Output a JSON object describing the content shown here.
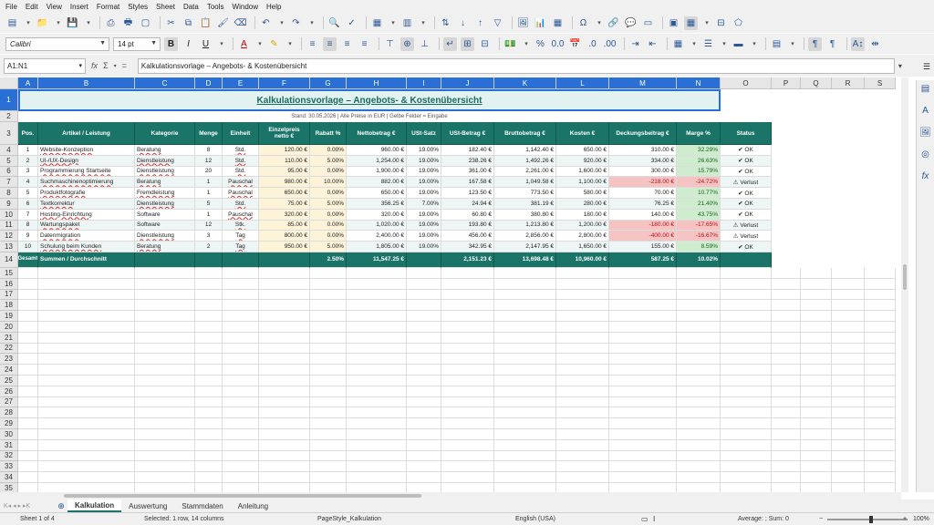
{
  "menu": [
    "File",
    "Edit",
    "View",
    "Insert",
    "Format",
    "Styles",
    "Sheet",
    "Data",
    "Tools",
    "Window",
    "Help"
  ],
  "toolbar": {
    "font_name": "Calibri",
    "font_size": "14 pt"
  },
  "formula_bar": {
    "name_box": "A1:N1",
    "sigma": "Σ",
    "equals": "=",
    "fx": "fx",
    "content": "Kalkulationsvorlage – Angebots- & Kostenübersicht"
  },
  "columns": [
    "A",
    "B",
    "C",
    "D",
    "E",
    "F",
    "G",
    "H",
    "I",
    "J",
    "K",
    "L",
    "M",
    "N",
    "O",
    "P",
    "Q",
    "R",
    "S"
  ],
  "rows": [
    "1",
    "2",
    "3",
    "4",
    "5",
    "6",
    "7",
    "8",
    "9",
    "10",
    "11",
    "12",
    "13",
    "14",
    "15",
    "16",
    "17",
    "18",
    "19",
    "20",
    "21",
    "22",
    "23",
    "24",
    "25",
    "26",
    "27",
    "28",
    "29",
    "30",
    "31",
    "32",
    "33",
    "34",
    "35",
    "36",
    "37"
  ],
  "sheet": {
    "title": "Kalkulationsvorlage – Angebots- & Kostenübersicht",
    "subtitle": "Stand: 30.05.2026  |  Alle Preise in EUR  |  Gelbe Felder = Eingabe",
    "headers": [
      "Pos.",
      "Artikel / Leistung",
      "Kategorie",
      "Menge",
      "Einheit",
      "Einzelpreis netto €",
      "Rabatt %",
      "Nettobetrag €",
      "USt-Satz",
      "USt-Betrag €",
      "Bruttobetrag €",
      "Kosten €",
      "Deckungsbeitrag €",
      "Marge %",
      "Status"
    ],
    "data": [
      [
        "1",
        "Website-Konzeption",
        "Beratung",
        "8",
        "Std.",
        "120.00 €",
        "0.00%",
        "960.00 €",
        "19.00%",
        "182.40 €",
        "1,142.40 €",
        "650.00 €",
        "310.00 €",
        "32.29%",
        "✔ OK"
      ],
      [
        "2",
        "UI-/UX-Design",
        "Dienstleistung",
        "12",
        "Std.",
        "110.00 €",
        "5.00%",
        "1,254.00 €",
        "19.00%",
        "238.26 €",
        "1,492.26 €",
        "920.00 €",
        "334.00 €",
        "26.63%",
        "✔ OK"
      ],
      [
        "3",
        "Programmierung Startseite",
        "Dienstleistung",
        "20",
        "Std.",
        "95.00 €",
        "0.00%",
        "1,900.00 €",
        "19.00%",
        "361.00 €",
        "2,261.00 €",
        "1,600.00 €",
        "300.00 €",
        "15.79%",
        "✔ OK"
      ],
      [
        "4",
        "Suchmaschinenoptimierung",
        "Beratung",
        "1",
        "Pauschal",
        "980.00 €",
        "10.00%",
        "882.00 €",
        "19.00%",
        "167.58 €",
        "1,049.58 €",
        "1,100.00 €",
        "-218.00 €",
        "-24.72%",
        "⚠ Verlust"
      ],
      [
        "5",
        "Produktfotografie",
        "Fremdleistung",
        "1",
        "Pauschal",
        "650.00 €",
        "0.00%",
        "650.00 €",
        "19.00%",
        "123.50 €",
        "773.50 €",
        "580.00 €",
        "70.00 €",
        "10.77%",
        "✔ OK"
      ],
      [
        "6",
        "Textkorrektur",
        "Dienstleistung",
        "5",
        "Std.",
        "75.00 €",
        "5.00%",
        "356.25 €",
        "7.00%",
        "24.94 €",
        "381.19 €",
        "280.00 €",
        "76.25 €",
        "21.40%",
        "✔ OK"
      ],
      [
        "7",
        "Hosting-Einrichtung",
        "Software",
        "1",
        "Pauschal",
        "320.00 €",
        "0.00%",
        "320.00 €",
        "19.00%",
        "60.80 €",
        "380.80 €",
        "180.00 €",
        "140.00 €",
        "43.75%",
        "✔ OK"
      ],
      [
        "8",
        "Wartungspaket",
        "Software",
        "12",
        "Stk.",
        "85.00 €",
        "0.00%",
        "1,020.00 €",
        "19.00%",
        "193.80 €",
        "1,213.80 €",
        "1,200.00 €",
        "-180.00 €",
        "-17.65%",
        "⚠ Verlust"
      ],
      [
        "9",
        "Datenmigration",
        "Dienstleistung",
        "3",
        "Tag",
        "800.00 €",
        "0.00%",
        "2,400.00 €",
        "19.00%",
        "456.00 €",
        "2,856.00 €",
        "2,800.00 €",
        "-400.00 €",
        "-16.67%",
        "⚠ Verlust"
      ],
      [
        "10",
        "Schulung beim Kunden",
        "Beratung",
        "2",
        "Tag",
        "950.00 €",
        "5.00%",
        "1,805.00 €",
        "19.00%",
        "342.95 €",
        "2,147.95 €",
        "1,650.00 €",
        "155.00 €",
        "8.59%",
        "✔ OK"
      ]
    ],
    "totals": [
      "Gesamt",
      "Summen / Durchschnitt",
      "",
      "",
      "",
      "",
      "2.50%",
      "11,547.25 €",
      "",
      "2,151.23 €",
      "13,698.48 €",
      "10,960.00 €",
      "587.25 €",
      "10.02%",
      ""
    ]
  },
  "tabs": [
    "Kalkulation",
    "Auswertung",
    "Stammdaten",
    "Anleitung"
  ],
  "tab_nav_label": "K◂ ◂ ▸ ▸K",
  "tab_add": "⊕",
  "status": {
    "sheet": "Sheet 1 of 4",
    "selection": "Selected: 1 row, 14 columns",
    "page_style": "PageStyle_Kalkulation",
    "language": "English (USA)",
    "summary": "Average: ; Sum: 0",
    "zoom_minus": "−",
    "zoom_plus": "+",
    "zoom": "100%"
  }
}
